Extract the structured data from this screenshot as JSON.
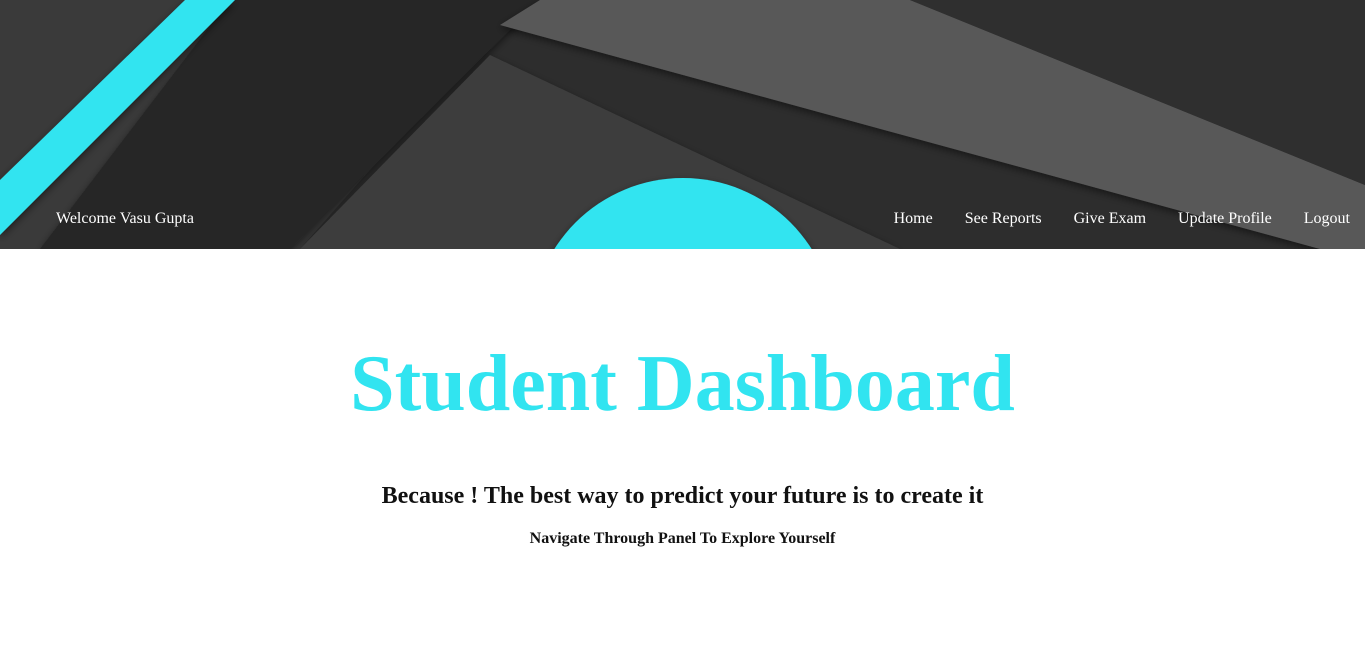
{
  "header": {
    "welcome_text": "Welcome Vasu Gupta",
    "nav": [
      {
        "label": "Home"
      },
      {
        "label": "See Reports"
      },
      {
        "label": "Give Exam"
      },
      {
        "label": "Update Profile"
      },
      {
        "label": "Logout"
      }
    ]
  },
  "main": {
    "title": "Student Dashboard",
    "tagline": "Because ! The best way to predict your future is to create it",
    "subline": "Navigate Through Panel To Explore Yourself"
  },
  "colors": {
    "accent": "#31e4f0",
    "header_dark": "#2b2b2b",
    "header_mid": "#3c3c3c",
    "header_light": "#5a5a5a",
    "text": "#111111"
  }
}
